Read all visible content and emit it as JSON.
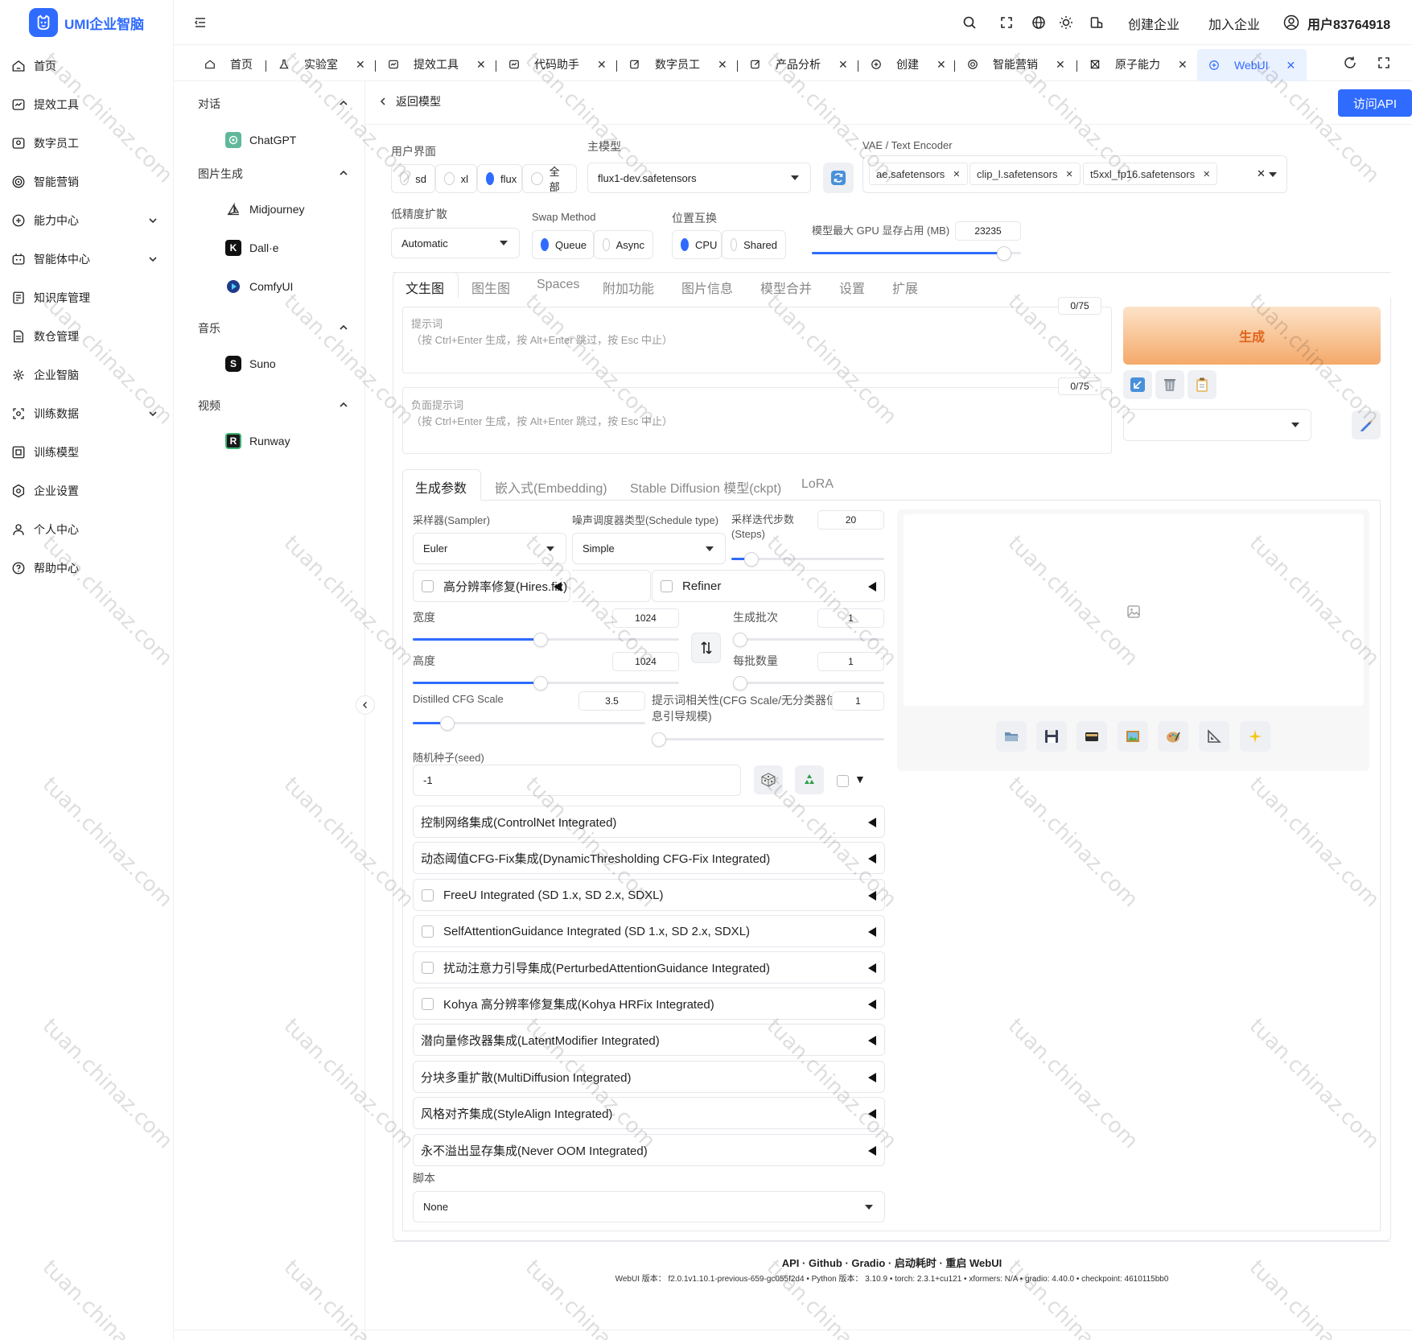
{
  "app": {
    "logo_text": "UMI企业智脑"
  },
  "sidebar": {
    "items": [
      {
        "label": "首页",
        "icon": "home-icon"
      },
      {
        "label": "提效工具",
        "icon": "tool-icon"
      },
      {
        "label": "数字员工",
        "icon": "digital-staff-icon"
      },
      {
        "label": "智能营销",
        "icon": "target-icon"
      },
      {
        "label": "能力中心",
        "icon": "ability-icon",
        "expandable": true
      },
      {
        "label": "智能体中心",
        "icon": "agent-icon",
        "expandable": true
      },
      {
        "label": "知识库管理",
        "icon": "knowledge-icon"
      },
      {
        "label": "数仓管理",
        "icon": "warehouse-icon"
      },
      {
        "label": "企业智脑",
        "icon": "brain-icon"
      },
      {
        "label": "训练数据",
        "icon": "training-data-icon",
        "expandable": true
      },
      {
        "label": "训练模型",
        "icon": "training-model-icon"
      },
      {
        "label": "企业设置",
        "icon": "settings-icon"
      },
      {
        "label": "个人中心",
        "icon": "user-icon"
      },
      {
        "label": "帮助中心",
        "icon": "help-icon"
      }
    ]
  },
  "subnav": {
    "groups": [
      {
        "title": "对话",
        "items": [
          {
            "label": "ChatGPT",
            "icon": "chatgpt-icon"
          }
        ]
      },
      {
        "title": "图片生成",
        "items": [
          {
            "label": "Midjourney",
            "icon": "midjourney-icon"
          },
          {
            "label": "Dall·e",
            "icon": "dalle-icon"
          },
          {
            "label": "ComfyUI",
            "icon": "comfyui-icon"
          }
        ]
      },
      {
        "title": "音乐",
        "items": [
          {
            "label": "Suno",
            "icon": "suno-icon"
          }
        ]
      },
      {
        "title": "视频",
        "items": [
          {
            "label": "Runway",
            "icon": "runway-icon"
          }
        ]
      }
    ]
  },
  "header": {
    "create_enterprise": "创建企业",
    "join_enterprise": "加入企业",
    "username": "用户83764918"
  },
  "tabs": [
    {
      "label": "首页",
      "closable": false
    },
    {
      "label": "实验室",
      "closable": true
    },
    {
      "label": "提效工具",
      "closable": true
    },
    {
      "label": "代码助手",
      "closable": true
    },
    {
      "label": "数字员工",
      "closable": true
    },
    {
      "label": "产品分析",
      "closable": true
    },
    {
      "label": "创建",
      "closable": true
    },
    {
      "label": "智能营销",
      "closable": true
    },
    {
      "label": "原子能力",
      "closable": true
    },
    {
      "label": "WebUI",
      "closable": true,
      "active": true
    }
  ],
  "page": {
    "back_label": "返回模型",
    "api_button": "访问API"
  },
  "webui": {
    "ui_label": "用户界面",
    "ui_options": [
      "sd",
      "xl",
      "flux",
      "全部"
    ],
    "ui_selected": "flux",
    "model_label": "主模型",
    "model_value": "flux1-dev.safetensors",
    "vae_label": "VAE / Text Encoder",
    "vae_tags": [
      "ae.safetensors",
      "clip_l.safetensors",
      "t5xxl_fp16.safetensors"
    ],
    "lowbit_label": "低精度扩散",
    "lowbit_value": "Automatic",
    "swap_label": "Swap Method",
    "swap_options": [
      "Queue",
      "Async"
    ],
    "swap_selected": "Queue",
    "loc_label": "位置互换",
    "loc_options": [
      "CPU",
      "Shared"
    ],
    "loc_selected": "CPU",
    "gpu_label": "模型最大 GPU 显存占用 (MB)",
    "gpu_value": "23235",
    "gpu_fraction": 0.92,
    "main_tabs": [
      "文生图",
      "图生图",
      "Spaces",
      "附加功能",
      "图片信息",
      "模型合并",
      "设置",
      "扩展"
    ],
    "prompt_label": "提示词",
    "prompt_hint": "（按 Ctrl+Enter 生成，按 Alt+Enter 跳过，按 Esc 中止）",
    "prompt_counter": "0/75",
    "neg_label": "负面提示词",
    "neg_hint": "（按 Ctrl+Enter 生成，按 Alt+Enter 跳过，按 Esc 中止）",
    "neg_counter": "0/75",
    "generate": "生成",
    "sub_tabs": [
      "生成参数",
      "嵌入式(Embedding)",
      "Stable Diffusion 模型(ckpt)",
      "LoRA"
    ],
    "sampler_label": "采样器(Sampler)",
    "sampler_value": "Euler",
    "schedule_label": "噪声调度器类型(Schedule type)",
    "schedule_value": "Simple",
    "steps_label_1": "采样迭代步数",
    "steps_label_2": "(Steps)",
    "steps_value": "20",
    "steps_fraction": 0.13,
    "hires_label": "高分辨率修复(Hires.fix)",
    "refiner_label": "Refiner",
    "width_label": "宽度",
    "width_value": "1024",
    "width_fraction": 0.48,
    "height_label": "高度",
    "height_value": "1024",
    "height_fraction": 0.48,
    "batch_count_label": "生成批次",
    "batch_count_value": "1",
    "batch_size_label": "每批数量",
    "batch_size_value": "1",
    "cfg_label": "Distilled CFG Scale",
    "cfg_value": "3.5",
    "cfg_fraction": 0.15,
    "cfg2_label_1": "提示词相关性(CFG Scale/无分类器信",
    "cfg2_label_2": "息引导规模)",
    "cfg2_value": "1",
    "seed_label": "随机种子(seed)",
    "seed_value": "-1",
    "accordions": [
      {
        "label": "控制网络集成(ControlNet Integrated)",
        "checkbox": false
      },
      {
        "label": "动态阈值CFG-Fix集成(DynamicThresholding CFG-Fix Integrated)",
        "checkbox": false
      },
      {
        "label": "FreeU Integrated (SD 1.x, SD 2.x, SDXL)",
        "checkbox": true
      },
      {
        "label": "SelfAttentionGuidance Integrated (SD 1.x, SD 2.x, SDXL)",
        "checkbox": true
      },
      {
        "label": "扰动注意力引导集成(PerturbedAttentionGuidance Integrated)",
        "checkbox": true
      },
      {
        "label": "Kohya 高分辨率修复集成(Kohya HRFix Integrated)",
        "checkbox": true
      },
      {
        "label": "潜向量修改器集成(LatentModifier Integrated)",
        "checkbox": false
      },
      {
        "label": "分块多重扩散(MultiDiffusion Integrated)",
        "checkbox": false
      },
      {
        "label": "风格对齐集成(StyleAlign Integrated)",
        "checkbox": false
      },
      {
        "label": "永不溢出显存集成(Never OOM Integrated)",
        "checkbox": false
      }
    ],
    "script_label": "脚本",
    "script_value": "None",
    "footer_links": "API · Github · Gradio · 启动耗时 · 重启 WebUI",
    "footer_version": "WebUI 版本： f2.0.1v1.10.1-previous-659-gc055f2d4 •  Python 版本： 3.10.9  •  torch: 2.3.1+cu121  •  xformers: N/A  •  gradio: 4.40.0  •  checkpoint: 4610115bb0"
  },
  "watermark": "tuan.chinaz.com",
  "colors": {
    "accent": "#2f6bff",
    "generate_from": "#fde3c8",
    "generate_to": "#f4a96a",
    "generate_text": "#e0641b"
  }
}
